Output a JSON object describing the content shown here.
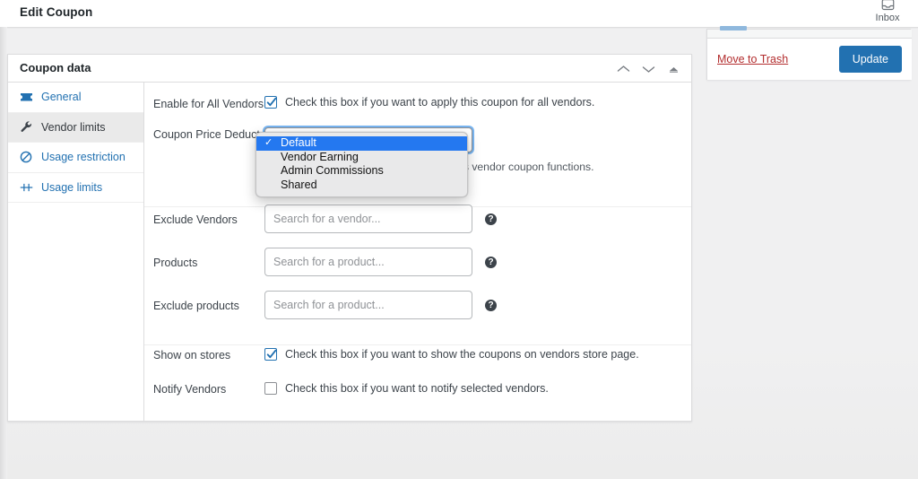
{
  "topbar": {
    "title": "Edit Coupon",
    "inbox_label": "Inbox",
    "inbox_icon": "inbox-tray-icon"
  },
  "metabox": {
    "title": "Coupon data",
    "handle_up_icon": "chevron-up-icon",
    "handle_down_icon": "chevron-down-icon",
    "handle_toggle_icon": "collapse-toggle-icon"
  },
  "tabs": [
    {
      "label": "General",
      "icon": "ticket-icon",
      "active": false
    },
    {
      "label": "Vendor limits",
      "icon": "wrench-icon",
      "active": true
    },
    {
      "label": "Usage restriction",
      "icon": "no-entry-icon",
      "active": false
    },
    {
      "label": "Usage limits",
      "icon": "limit-marker-icon",
      "active": false
    }
  ],
  "fields": {
    "enable_all_vendors": {
      "label": "Enable for All Vendors",
      "checkbox_text": "Check this box if you want to apply this coupon for all vendors.",
      "checked": true
    },
    "coupon_price_deduct": {
      "label": "Coupon Price Deduct",
      "selected_value": "Default",
      "options": [
        "Default",
        "Vendor Earning",
        "Admin Commissions",
        "Shared"
      ],
      "description_visible_fragment": "ssion and vendor earning, it's the same as vendor",
      "description_second_line": "coupon functions."
    },
    "exclude_vendors": {
      "label": "Exclude Vendors",
      "placeholder": "Search for a vendor...",
      "value": "",
      "help_icon": "question-mark-icon"
    },
    "products": {
      "label": "Products",
      "placeholder": "Search for a product...",
      "value": "",
      "help_icon": "question-mark-icon"
    },
    "exclude_products": {
      "label": "Exclude products",
      "placeholder": "Search for a product...",
      "value": "",
      "help_icon": "question-mark-icon"
    },
    "show_on_stores": {
      "label": "Show on stores",
      "checkbox_text": "Check this box if you want to show the coupons on vendors store page.",
      "checked": true
    },
    "notify_vendors": {
      "label": "Notify Vendors",
      "checkbox_text": "Check this box if you want to notify selected vendors.",
      "checked": false
    }
  },
  "publish": {
    "trash_label": "Move to Trash",
    "update_label": "Update"
  },
  "colors": {
    "accent_blue": "#2271b1",
    "highlight_blue": "#2478f0",
    "danger_red": "#b32d2e",
    "body_bg": "#f0f0f1",
    "border": "#dcdcde",
    "active_tab_bg": "#eaeaea"
  }
}
